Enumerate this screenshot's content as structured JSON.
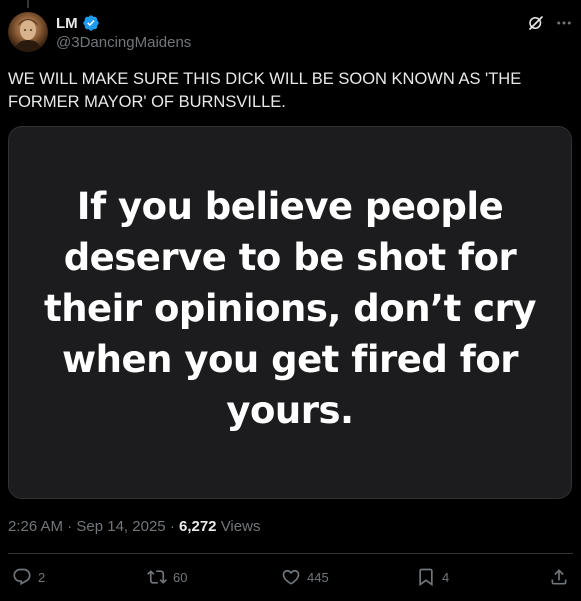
{
  "author": {
    "display_name": "LM",
    "handle": "@3DancingMaidens",
    "verified": true,
    "verified_color": "#1d9bf0"
  },
  "tweet": {
    "text": "WE WILL MAKE SURE THIS DICK WILL BE SOON KNOWN AS 'THE FORMER MAYOR' OF BURNSVILLE.",
    "image_text": "If you believe people deserve to be shot for their opinions, don’t cry when you get fired for yours."
  },
  "meta": {
    "time": "2:26 AM",
    "separator": "·",
    "date": "Sep 14, 2025",
    "views_count": "6,272",
    "views_label": "Views"
  },
  "actions": {
    "reply_count": "2",
    "repost_count": "60",
    "like_count": "445",
    "bookmark_count": "4"
  },
  "icons": {
    "header_right": [
      "grok-icon",
      "more-icon"
    ],
    "action_bar": [
      "reply-icon",
      "repost-icon",
      "like-icon",
      "bookmark-icon",
      "share-icon"
    ]
  }
}
